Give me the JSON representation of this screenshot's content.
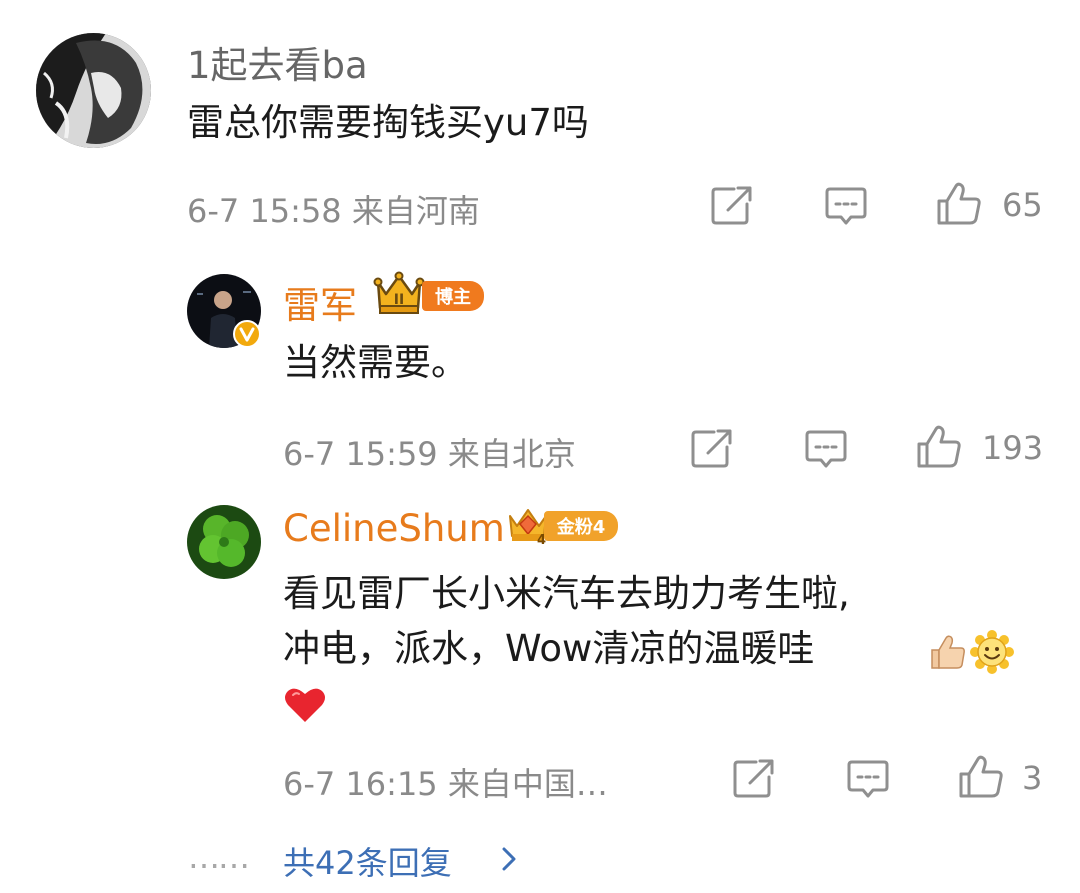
{
  "colors": {
    "accent_name": "#e77b1c",
    "meta": "#8a8a8a",
    "link": "#3d6fb5",
    "verified": "#f2a90d",
    "fan_badge": "#f1a22a"
  },
  "comments": [
    {
      "username": "1起去看ba",
      "text": "雷总你需要掏钱买yu7吗",
      "meta": "6-7 15:58 来自河南",
      "likes": "65",
      "icons": [
        "share-icon",
        "comment-icon",
        "like-icon"
      ]
    },
    {
      "username": "雷军",
      "badge": "博主",
      "text": "当然需要。",
      "meta": "6-7 15:59 来自北京",
      "likes": "193",
      "icons": [
        "crown-icon",
        "verified-icon",
        "share-icon",
        "comment-icon",
        "like-icon"
      ]
    },
    {
      "username": "CelineShum",
      "badge": "金粉4",
      "text_lines": [
        "看见雷厂长小米汽车去助力考生啦,",
        "冲电，派水，Wow清凉的温暖哇"
      ],
      "meta": "6-7 16:15 来自中国…",
      "likes": "3",
      "icons": [
        "fan-crown-icon",
        "thumbs-up-emoji-icon",
        "smile-emoji-icon",
        "heart-emoji-icon",
        "share-icon",
        "comment-icon",
        "like-icon"
      ]
    }
  ],
  "replies": {
    "dots": "……",
    "label": "共42条回复"
  }
}
